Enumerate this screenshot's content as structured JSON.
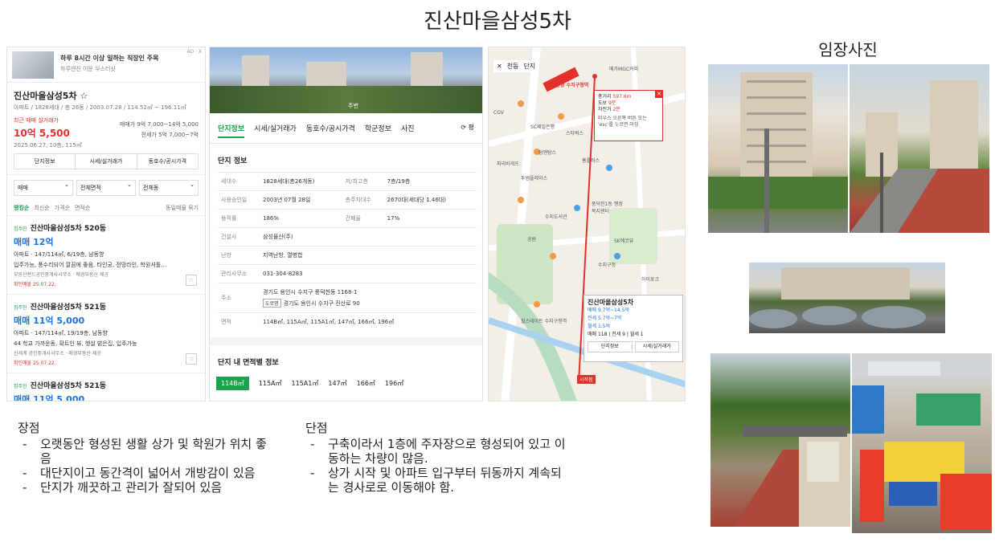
{
  "title": "진산마을삼성5차",
  "photo_title": "임장사진",
  "left_panel": {
    "ad": {
      "line1": "하루 8시간 이상 일하는 직장인 주목",
      "line2": "하루엔진 이뮨 부스터샷",
      "tag": "AD · X"
    },
    "complex_name": "진산마을삼성5차 ☆",
    "complex_meta": "아파트 / 1828세대 / 총 26동 / 2003.07.28 / 114.52㎡ ~ 196.11㎡",
    "recent_label": "최근 매매 실거래가",
    "recent_price": "10억 5,500",
    "recent_date": "2025.06.27, 10층, 115㎡",
    "sale_line": "매매가 9억 7,000~14억 5,000",
    "jeonse_line": "전세가 5억 7,000~7억",
    "buttons": [
      "단지정보",
      "시세/실거래가",
      "동호수/공시가격"
    ],
    "filters": [
      "매매",
      "전체면적",
      "전체동"
    ],
    "sort": [
      "랭킹순",
      "최신순",
      "가격순",
      "면적순"
    ],
    "sort_check": "동일매물 묶기",
    "listings": [
      {
        "tag": "집주인",
        "title": "진산마을삼성5차 520동",
        "price": "매매 12억",
        "desc": "아파트 · 147/114㎡, 6/19층, 남동향",
        "desc2": "입주가능, 풍수리되어 깔끔에 좋음, 타인궁, 전망라인, 학원셔틀…",
        "agency": "부동산랜드공인중개사사무소 · 매경부동산 제공",
        "confirmed": "확인매물 25.07.22."
      },
      {
        "tag": "집주인",
        "title": "진산마을삼성5차 521동",
        "price": "매매 11억 5,000",
        "desc": "아파트 · 147/114㎡, 19/19층, 남동향",
        "desc2": "44 학교 가까운동, 확트인 뷰, 햇살 밝은집, 입주가능",
        "agency": "신세계 공인중개사사무소 · 매경부동산 제공",
        "confirmed": "확인매물 25.07.22."
      },
      {
        "tag": "집주인",
        "title": "진산마을삼성5차 521동",
        "price": "매매 11억 5,000"
      }
    ]
  },
  "mid_panel": {
    "photo_label": "주변",
    "tabs": [
      "단지정보",
      "시세/실거래가",
      "동호수/공시가격",
      "학군정보",
      "사진"
    ],
    "tab_more": "⟳ 평",
    "section_title": "단지 정보",
    "info": {
      "households_k": "세대수",
      "households_v": "1828세대(총26개동)",
      "floors_k": "저/최고층",
      "floors_v": "7층/19층",
      "approval_k": "사용승인일",
      "approval_v": "2003년 07월 28일",
      "parking_k": "총주차대수",
      "parking_v": "2670대(세대당 1.46대)",
      "far_k": "용적률",
      "far_v": "186%",
      "bcr_k": "건폐율",
      "bcr_v": "17%",
      "builder_k": "건설사",
      "builder_v": "삼성물산(주)",
      "heating_k": "난방",
      "heating_v": "지역난방, 열병합",
      "office_k": "관리사무소",
      "office_v": "031-304-8283",
      "address_k": "주소",
      "address_v1": "경기도 용인시 수지구 풍덕천동 1168-1",
      "road_tag": "도로명",
      "address_v2": "경기도 용인시 수지구 진산로 90",
      "area_k": "면적",
      "area_v": "114B㎡, 115A㎡, 115A1㎡, 147㎡, 166㎡, 196㎡"
    },
    "area_section_title": "단지 내 면적별 정보",
    "area_tabs": [
      "114B㎡",
      "115A㎡",
      "115A1㎡",
      "147㎡",
      "166㎡",
      "196㎡"
    ]
  },
  "map": {
    "location": "천동",
    "type_select": "단지",
    "popup": {
      "line1_k": "총거리",
      "line1_v": "597.6m",
      "line2_k": "도보",
      "line2_v": "9분",
      "line3_k": "자전거",
      "line3_v": "2분",
      "hint": "마우스 오른쪽 버튼 또는 'esc'를 누르면 마침"
    },
    "station": "신분당 수지구청역",
    "labels": [
      "CGV",
      "SC제일은행",
      "메가MGC커피",
      "스타벅스",
      "파리바게뜨",
      "탐앤탐스",
      "투썸플레이스",
      "홈플러스",
      "수지도서관",
      "공원",
      "SK에코뷰",
      "수지구청",
      "힐스테이트 수지구청역",
      "풍덕천1동 행정복지센터",
      "하이포크"
    ],
    "card": {
      "title": "진산마을삼성5차",
      "sale": "매매 9.7억~14.5억",
      "jeonse": "전세 5.7억~7억",
      "monthly": "월세 1.5억",
      "counts": "매매 118 | 전세 9 | 월세 1",
      "btn1": "단지정보",
      "btn2": "시세/실거래가"
    },
    "end_label": "시작점"
  },
  "pros": {
    "header": "장점",
    "items": [
      "오랫동안 형성된 생활 상가 및 학원가 위치 좋음",
      "대단지이고 동간격이 넓어서 개방감이 있음",
      "단지가 깨끗하고 관리가 잘되어 있음"
    ]
  },
  "cons": {
    "header": "단점",
    "items": [
      "구축이라서 1층에 주자장으로 형성되어 있고 이동하는 차량이 많음.",
      "상가 시작 및 아파트 입구부터 뒤동까지 계속되는 경사로로 이동해야 함."
    ]
  },
  "colors": {
    "green": "#1aa34a",
    "red": "#e4302b",
    "blue": "#1973e8"
  }
}
